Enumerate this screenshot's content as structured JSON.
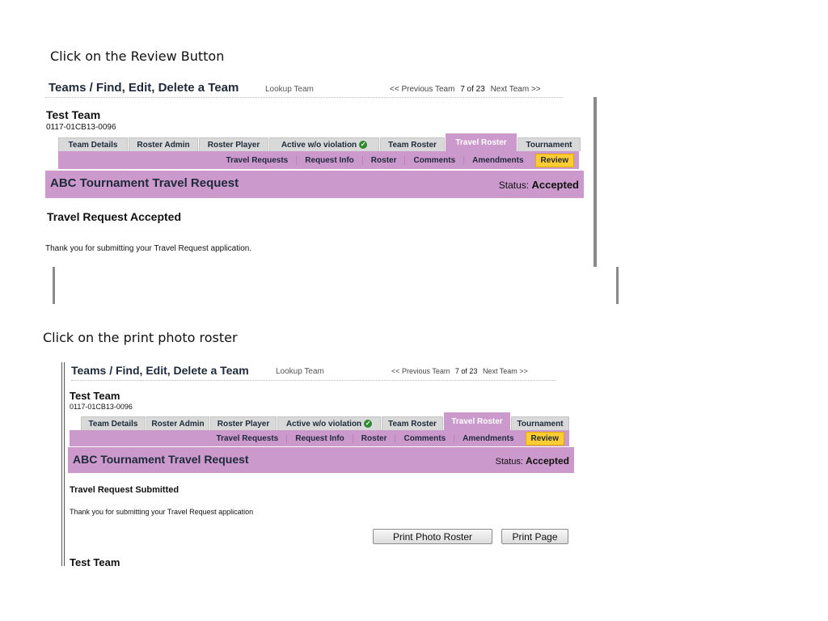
{
  "captions": {
    "step1": "Click on the Review Button",
    "step2": "Click on the print photo roster"
  },
  "header": {
    "title": "Teams / Find, Edit, Delete a Team",
    "lookup": "Lookup Team",
    "prev": "<< Previous Team",
    "position": "7 of 23",
    "next": "Next Team >>"
  },
  "team": {
    "name": "Test Team",
    "code": "0117-01CB13-0096"
  },
  "tabs": [
    "Team Details",
    "Roster Admin",
    "Roster Player",
    "Active w/o violation",
    "Team Roster",
    "Travel Roster",
    "Tournament"
  ],
  "subnav": [
    "Travel Requests",
    "Request Info",
    "Roster",
    "Comments",
    "Amendments",
    "Review"
  ],
  "request": {
    "title": "ABC Tournament Travel Request",
    "status_label": "Status:",
    "status_value": "Accepted"
  },
  "screen1": {
    "heading": "Travel Request Accepted",
    "message": "Thank you for submitting your Travel Request application."
  },
  "screen2": {
    "heading": "Travel Request Submitted",
    "message": "Thank you for submitting your Travel Request application",
    "print_photo_roster": "Print Photo Roster",
    "print_page": "Print Page",
    "footer_team": "Test Team"
  },
  "colors": {
    "tab_accent": "#cc99cc",
    "review_highlight": "#ffcc33"
  }
}
